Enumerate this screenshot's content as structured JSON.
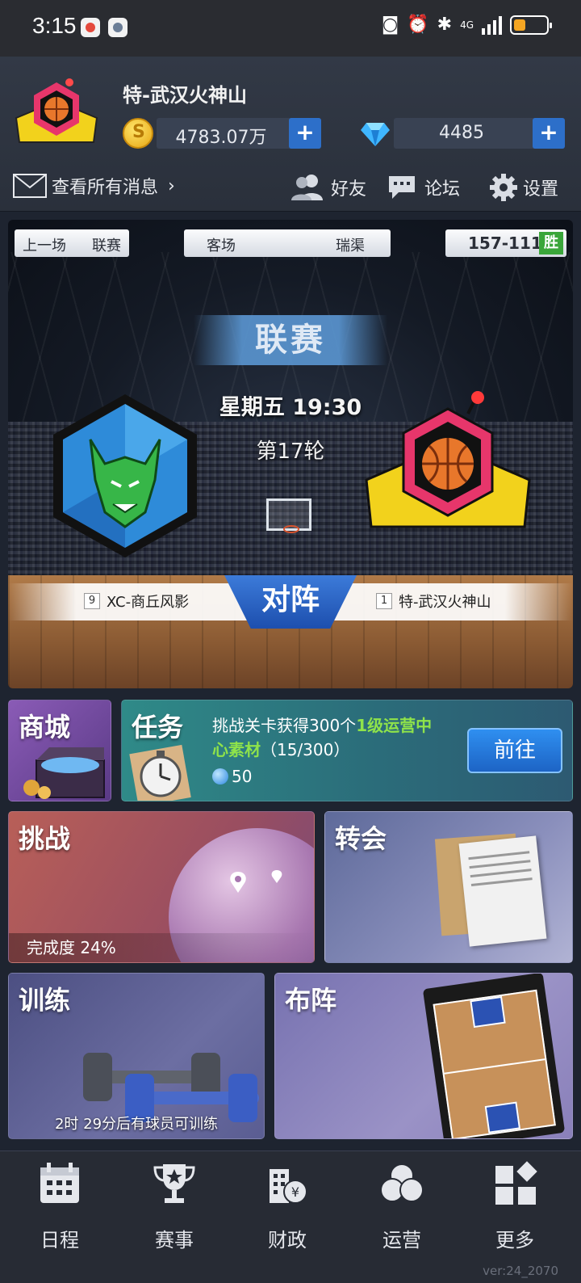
{
  "status_bar": {
    "time": "3:15",
    "network": "4G"
  },
  "header": {
    "team_name": "特-武汉火神山",
    "coins": "4783.07万",
    "diamonds": "4485",
    "plus_label": "+",
    "messages_label": "查看所有消息",
    "nav": [
      {
        "label": "好友",
        "icon": "friends-icon"
      },
      {
        "label": "论坛",
        "icon": "forum-icon"
      },
      {
        "label": "设置",
        "icon": "gear-icon"
      }
    ]
  },
  "match": {
    "last_game_label": "上一场",
    "last_game_type": "联赛",
    "venue": "客场",
    "opponent_short": "瑞渠",
    "last_score": "157-111",
    "last_result": "胜",
    "league_label": "联赛",
    "time": "星期五 19:30",
    "round": "第17轮",
    "vs_label": "对阵",
    "home": {
      "rank": "9",
      "name": "XC-商丘风影"
    },
    "away": {
      "rank": "1",
      "name": "特-武汉火神山"
    }
  },
  "cards": {
    "shop_title": "商城",
    "task_title": "任务",
    "task_desc_pre": "挑战关卡获得300个",
    "task_desc_hl": "1级运营中心素材",
    "task_desc_post": "（15/300）",
    "task_reward": "50",
    "task_button": "前往",
    "challenge_title": "挑战",
    "challenge_progress_label": "完成度 24%",
    "challenge_progress": 0.24,
    "transfer_title": "转会",
    "training_title": "训练",
    "training_note": "2时 29分后有球员可训练",
    "lineup_title": "布阵"
  },
  "bottom_nav": [
    {
      "label": "日程",
      "icon": "calendar-icon"
    },
    {
      "label": "赛事",
      "icon": "trophy-icon"
    },
    {
      "label": "财政",
      "icon": "finance-icon"
    },
    {
      "label": "运营",
      "icon": "operations-icon"
    },
    {
      "label": "更多",
      "icon": "more-icon"
    }
  ],
  "version": "ver:24_2070",
  "colors": {
    "accent_blue": "#2d6fc9",
    "win_green": "#3aa63a",
    "highlight_green": "#8fe34a"
  }
}
